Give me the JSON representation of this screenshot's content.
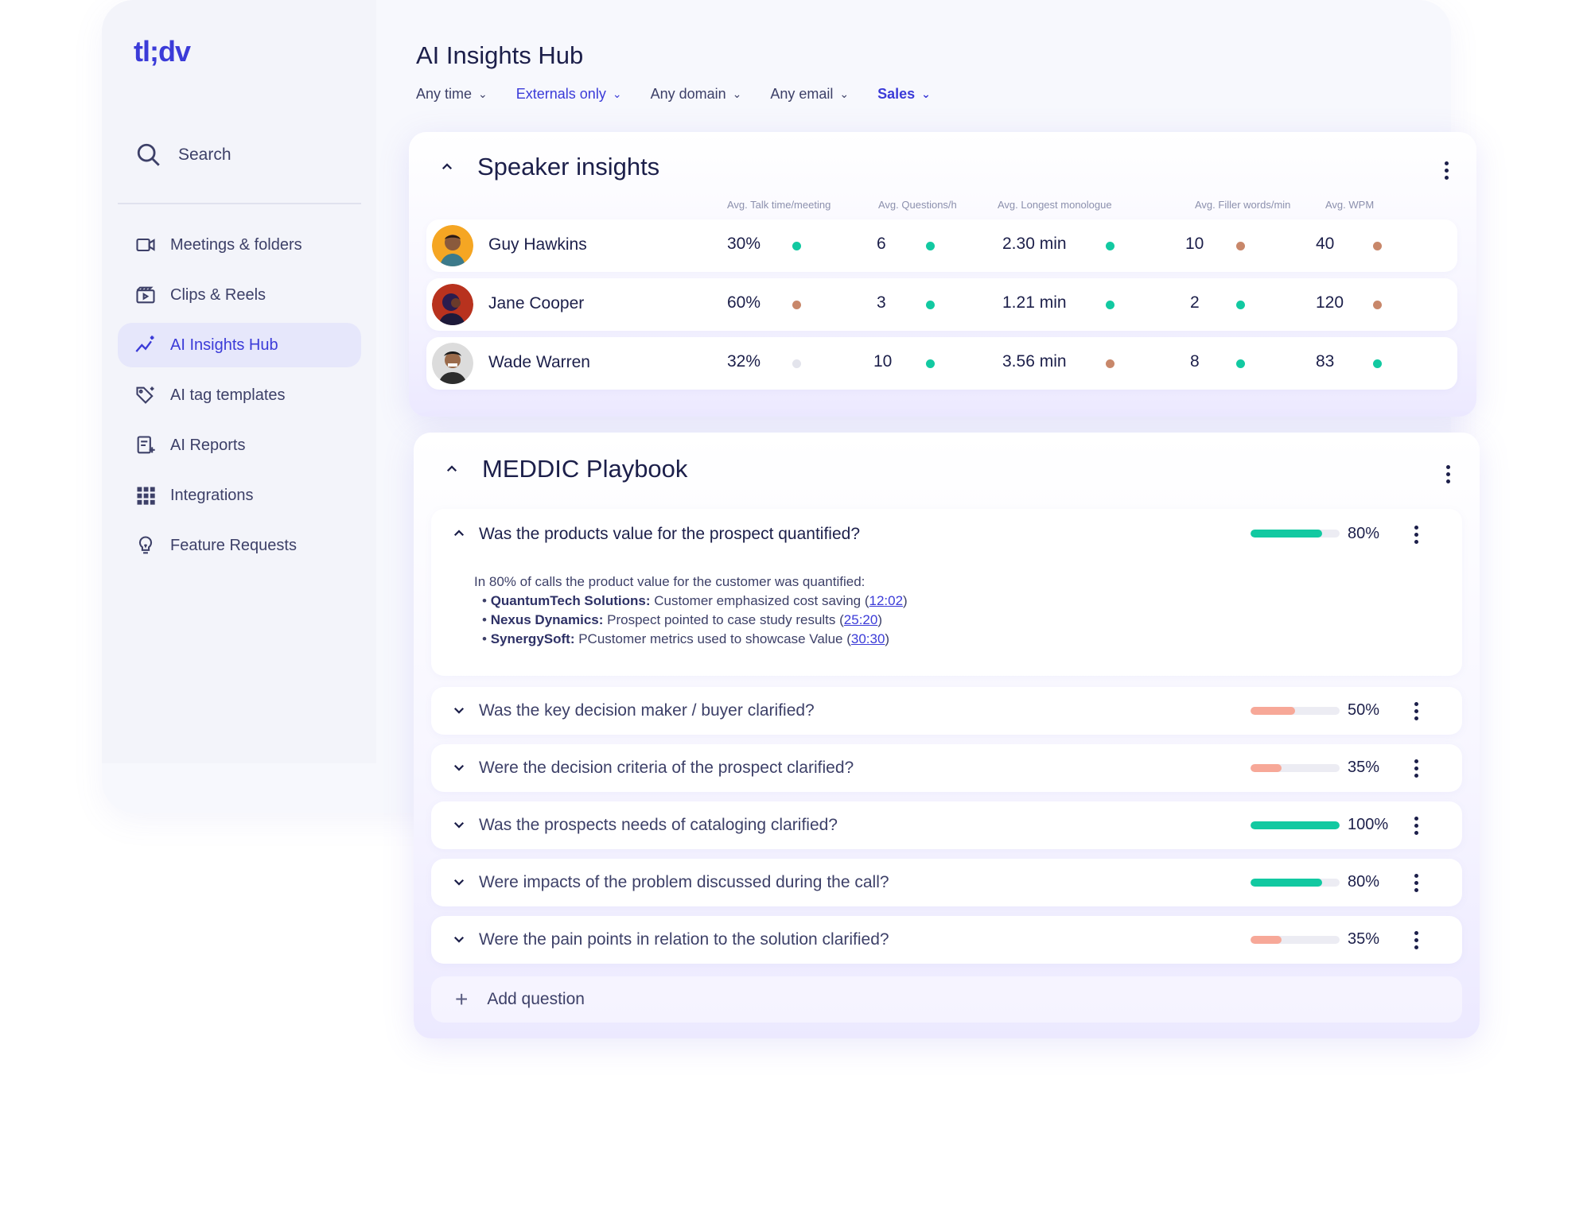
{
  "app": {
    "logo": "tl;dv",
    "page_title": "AI Insights Hub"
  },
  "sidebar": {
    "search_label": "Search",
    "items": [
      {
        "label": "Meetings & folders",
        "icon": "video-camera-icon"
      },
      {
        "label": "Clips & Reels",
        "icon": "clapperboard-icon"
      },
      {
        "label": "AI Insights Hub",
        "icon": "sparkle-chart-icon",
        "active": true
      },
      {
        "label": "AI tag templates",
        "icon": "tag-sparkle-icon"
      },
      {
        "label": "AI Reports",
        "icon": "report-icon"
      },
      {
        "label": "Integrations",
        "icon": "grid-icon"
      },
      {
        "label": "Feature Requests",
        "icon": "lightbulb-icon"
      }
    ]
  },
  "filters": [
    {
      "label": "Any time"
    },
    {
      "label": "Externals only"
    },
    {
      "label": "Any domain"
    },
    {
      "label": "Any email"
    },
    {
      "label": "Sales"
    }
  ],
  "speaker_insights": {
    "title": "Speaker insights",
    "columns": [
      "Avg. Talk time/meeting",
      "Avg. Questions/h",
      "Avg. Longest monologue",
      "Avg. Filler words/min",
      "Avg. WPM"
    ],
    "rows": [
      {
        "name": "Guy Hawkins",
        "talk": "30%",
        "questions": "6",
        "monologue": "2.30 min",
        "filler": "10",
        "wpm": "40",
        "status": [
          "good",
          "good",
          "good",
          "warn",
          "warn"
        ]
      },
      {
        "name": "Jane Cooper",
        "talk": "60%",
        "questions": "3",
        "monologue": "1.21 min",
        "filler": "2",
        "wpm": "120",
        "status": [
          "warn",
          "good",
          "good",
          "good",
          "warn"
        ]
      },
      {
        "name": "Wade Warren",
        "talk": "32%",
        "questions": "10",
        "monologue": "3.56 min",
        "filler": "8",
        "wpm": "83",
        "status": [
          "neutral",
          "good",
          "warn",
          "good",
          "good"
        ]
      }
    ]
  },
  "status_colors": {
    "good": "#12c9a1",
    "warn": "#c8876a",
    "neutral": "#e3e4ec"
  },
  "meddic": {
    "title": "MEDDIC Playbook",
    "questions": [
      {
        "text": "Was the products value for the prospect quantified?",
        "pct": "80%",
        "value": 80,
        "expanded": true
      },
      {
        "text": "Was the key decision maker / buyer clarified?",
        "pct": "50%",
        "value": 50
      },
      {
        "text": "Were the decision criteria of the prospect clarified?",
        "pct": "35%",
        "value": 35
      },
      {
        "text": "Was the prospects needs of cataloging clarified?",
        "pct": "100%",
        "value": 100
      },
      {
        "text": "Were impacts of the problem discussed during the call?",
        "pct": "80%",
        "value": 80
      },
      {
        "text": "Were the pain points in relation to the solution clarified?",
        "pct": "35%",
        "value": 35
      }
    ],
    "detail": {
      "intro": "In 80% of calls the product value for the customer was quantified:",
      "items": [
        {
          "company": "QuantumTech Solutions:",
          "text": " Customer emphasized cost saving (",
          "time": "12:02",
          "close": ")"
        },
        {
          "company": "Nexus Dynamics:",
          "text": " Prospect pointed to case study results (",
          "time": "25:20",
          "close": ")"
        },
        {
          "company": "SynergySoft:",
          "text": " PCustomer metrics used to showcase Value (",
          "time": "30:30",
          "close": ")"
        }
      ]
    },
    "add_label": "Add question",
    "colors": {
      "high": "#12c9a1",
      "low": "#f7a898"
    }
  }
}
